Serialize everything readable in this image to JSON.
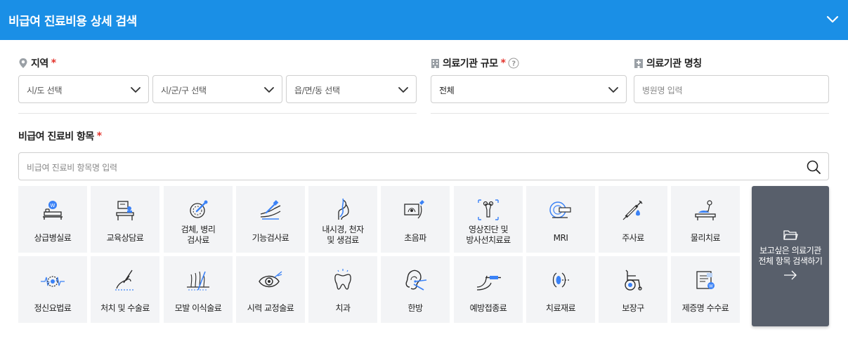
{
  "header": {
    "title": "비급여 진료비용 상세 검색",
    "toggle_icon": "chevron-down-icon"
  },
  "region": {
    "label": "지역",
    "required_mark": "*",
    "sido_placeholder": "시/도 선택",
    "sigungu_placeholder": "시/군/구 선택",
    "eupmyeondong_placeholder": "읍/면/동 선택"
  },
  "institution_scale": {
    "label": "의료기관 규모",
    "required_mark": "*",
    "help_icon": "question-circle-icon",
    "selected": "전체"
  },
  "institution_name": {
    "label": "의료기관 명칭",
    "placeholder": "병원명 입력"
  },
  "items": {
    "label": "비급여 진료비 항목",
    "required_mark": "*",
    "search_placeholder": "비급여 진료비 항목명 입력",
    "categories": [
      {
        "label": "상급병실료",
        "icon": "hospital-bed-icon"
      },
      {
        "label": "교육상담료",
        "icon": "counseling-desk-icon"
      },
      {
        "label": "검체, 병리\n검사료",
        "icon": "specimen-dish-icon"
      },
      {
        "label": "기능검사료",
        "icon": "arm-test-icon"
      },
      {
        "label": "내시경, 천자\n및 생검료",
        "icon": "endoscope-icon"
      },
      {
        "label": "초음파",
        "icon": "ultrasound-icon"
      },
      {
        "label": "영상진단 및\n방사선치료료",
        "icon": "xray-bone-icon"
      },
      {
        "label": "MRI",
        "icon": "mri-scanner-icon"
      },
      {
        "label": "주사료",
        "icon": "syringe-icon"
      },
      {
        "label": "물리치료",
        "icon": "physical-therapy-icon"
      },
      {
        "label": "정신요법료",
        "icon": "brain-wave-icon"
      },
      {
        "label": "처치 및 수술료",
        "icon": "scalpel-hand-icon"
      },
      {
        "label": "모발 이식술료",
        "icon": "hair-transplant-icon"
      },
      {
        "label": "시력 교정술료",
        "icon": "eye-laser-icon"
      },
      {
        "label": "치과",
        "icon": "tooth-icon"
      },
      {
        "label": "한방",
        "icon": "ear-acupuncture-icon"
      },
      {
        "label": "예방접종료",
        "icon": "vaccination-arm-icon"
      },
      {
        "label": "치료재료",
        "icon": "lens-material-icon"
      },
      {
        "label": "보장구",
        "icon": "wheelchair-icon"
      },
      {
        "label": "제증명 수수료",
        "icon": "certificate-document-icon"
      }
    ]
  },
  "view_all": {
    "label": "보고싶은 의료기관\n전체 항목 검색하기",
    "folder_icon": "folder-open-icon",
    "arrow_icon": "arrow-right-icon"
  },
  "colors": {
    "primary": "#1a8fe6",
    "required": "#e3322b",
    "icon_blue": "#3b82f6",
    "tile_bg": "#f3f4f6",
    "dark_button": "#585f6b"
  }
}
